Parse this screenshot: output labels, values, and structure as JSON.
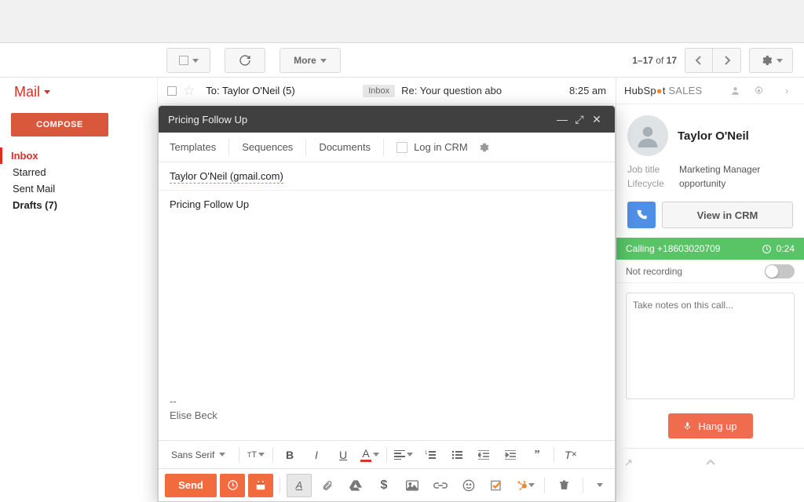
{
  "header": {
    "mail_label": "Mail",
    "more_label": "More",
    "range": "1–17",
    "of": "of",
    "total": "17"
  },
  "sidebar": {
    "compose": "COMPOSE",
    "items": [
      {
        "label": "Inbox",
        "active": true,
        "bold": false
      },
      {
        "label": "Starred",
        "active": false,
        "bold": false
      },
      {
        "label": "Sent Mail",
        "active": false,
        "bold": false
      },
      {
        "label": "Drafts (7)",
        "active": false,
        "bold": true
      }
    ]
  },
  "list": {
    "row0": {
      "to": "To: Taylor O'Neil (5)",
      "label": "Inbox",
      "subject": "Re: Your question abo",
      "time": "8:25 am"
    }
  },
  "compose": {
    "title": "Pricing Follow Up",
    "tabs": {
      "templates": "Templates",
      "sequences": "Sequences",
      "documents": "Documents",
      "logcrm": "Log in CRM"
    },
    "to_chip": "Taylor O'Neil (gmail.com)",
    "subject": "Pricing Follow Up",
    "sig_dash": "--",
    "signature": "Elise Beck",
    "font": "Sans Serif",
    "send": "Send"
  },
  "hubspot": {
    "brand_a": "HubSp",
    "brand_b": "t",
    "brand_c": " SALES",
    "contact_name": "Taylor O'Neil",
    "jobtitle_k": "Job title",
    "jobtitle_v": "Marketing Manager",
    "lifecycle_k": "Lifecycle",
    "lifecycle_v": "opportunity",
    "view_crm": "View in CRM",
    "calling_prefix": "Calling ",
    "calling_number": "+18603020709",
    "call_timer": "0:24",
    "recording": "Not recording",
    "notes_placeholder": "Take notes on this call...",
    "hangup": "Hang up"
  }
}
